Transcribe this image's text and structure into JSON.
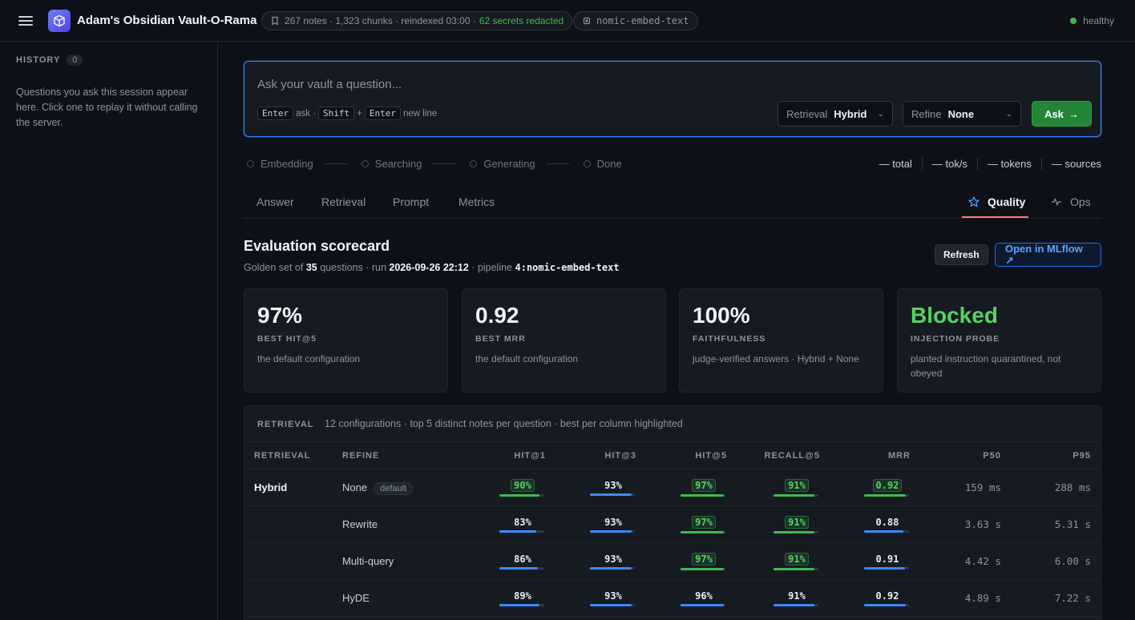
{
  "header": {
    "title": "Adam's Obsidian Vault-O-Rama",
    "index_info": "267 notes · 1,323 chunks · reindexed 03:00 ·",
    "secrets": "62 secrets redacted",
    "model": "nomic-embed-text",
    "status": "healthy",
    "status_color": "#3fb950"
  },
  "sidebar": {
    "history_label": "HISTORY",
    "history_count": "0",
    "description": "Questions you ask this session appear here. Click one to replay it without calling the server."
  },
  "ask": {
    "placeholder": "Ask your vault a question...",
    "hint_enter": "Enter",
    "hint_ask": "ask ·",
    "hint_shift": "Shift",
    "hint_plus": "+",
    "hint_enter2": "Enter",
    "hint_newline": "new line",
    "retrieval_label": "Retrieval",
    "retrieval_value": "Hybrid",
    "refine_label": "Refine",
    "refine_value": "None",
    "ask_button": "Ask"
  },
  "steps": [
    "Embedding",
    "Searching",
    "Generating",
    "Done"
  ],
  "stats": [
    "— total",
    "— tok/s",
    "— tokens",
    "— sources"
  ],
  "tabs": {
    "answer": "Answer",
    "retrieval": "Retrieval",
    "prompt": "Prompt",
    "metrics": "Metrics",
    "quality": "Quality",
    "ops": "Ops"
  },
  "scorecard": {
    "title": "Evaluation scorecard",
    "sub_prefix": "Golden set of",
    "questions": "35",
    "sub_mid": "questions · run",
    "run": "2026-09-26 22:12",
    "sub_pipe": "· pipeline",
    "pipeline": "4:nomic-embed-text",
    "refresh": "Refresh",
    "open_mlflow": "Open in MLflow ↗"
  },
  "cards": [
    {
      "big": "97%",
      "cap": "BEST HIT@5",
      "note": "the default configuration"
    },
    {
      "big": "0.92",
      "cap": "BEST MRR",
      "note": "the default configuration"
    },
    {
      "big": "100%",
      "cap": "FAITHFULNESS",
      "note": "judge-verified answers · Hybrid + None"
    },
    {
      "big": "Blocked",
      "cap": "INJECTION PROBE",
      "note": "planted instruction quarantined, not obeyed"
    }
  ],
  "table": {
    "label": "RETRIEVAL",
    "description": "12 configurations · top 5 distinct notes per question · best per column highlighted",
    "columns": [
      "RETRIEVAL",
      "REFINE",
      "HIT@1",
      "HIT@3",
      "HIT@5",
      "RECALL@5",
      "MRR",
      "P50",
      "P95"
    ],
    "default_tag": "default",
    "rows": [
      {
        "retrieval": "Hybrid",
        "refine": "None",
        "hit1": "90%",
        "hit3": "93%",
        "hit5": "97%",
        "recall5": "91%",
        "mrr": "0.92",
        "p50": "159 ms",
        "p95": "288 ms",
        "hit1_f": 0.9,
        "hit3_f": 0.93,
        "hit5_f": 0.97,
        "recall5_f": 0.91,
        "mrr_f": 0.92,
        "best": {
          "hit1": true,
          "hit3": false,
          "hit5": true,
          "recall5": true,
          "mrr": true
        }
      },
      {
        "retrieval": "",
        "refine": "Rewrite",
        "hit1": "83%",
        "hit3": "93%",
        "hit5": "97%",
        "recall5": "91%",
        "mrr": "0.88",
        "p50": "3.63 s",
        "p95": "5.31 s",
        "hit1_f": 0.83,
        "hit3_f": 0.93,
        "hit5_f": 0.97,
        "recall5_f": 0.91,
        "mrr_f": 0.88,
        "best": {
          "hit1": false,
          "hit3": false,
          "hit5": true,
          "recall5": true,
          "mrr": false
        }
      },
      {
        "retrieval": "",
        "refine": "Multi-query",
        "hit1": "86%",
        "hit3": "93%",
        "hit5": "97%",
        "recall5": "91%",
        "mrr": "0.91",
        "p50": "4.42 s",
        "p95": "6.00 s",
        "hit1_f": 0.86,
        "hit3_f": 0.93,
        "hit5_f": 0.97,
        "recall5_f": 0.91,
        "mrr_f": 0.91,
        "best": {
          "hit1": false,
          "hit3": false,
          "hit5": true,
          "recall5": true,
          "mrr": false
        }
      },
      {
        "retrieval": "",
        "refine": "HyDE",
        "hit1": "89%",
        "hit3": "93%",
        "hit5": "96%",
        "recall5": "91%",
        "mrr": "0.92",
        "p50": "4.89 s",
        "p95": "7.22 s",
        "hit1_f": 0.89,
        "hit3_f": 0.93,
        "hit5_f": 0.96,
        "recall5_f": 0.91,
        "mrr_f": 0.92,
        "best": {
          "hit1": false,
          "hit3": false,
          "hit5": false,
          "recall5": false,
          "mrr": false
        }
      }
    ]
  }
}
